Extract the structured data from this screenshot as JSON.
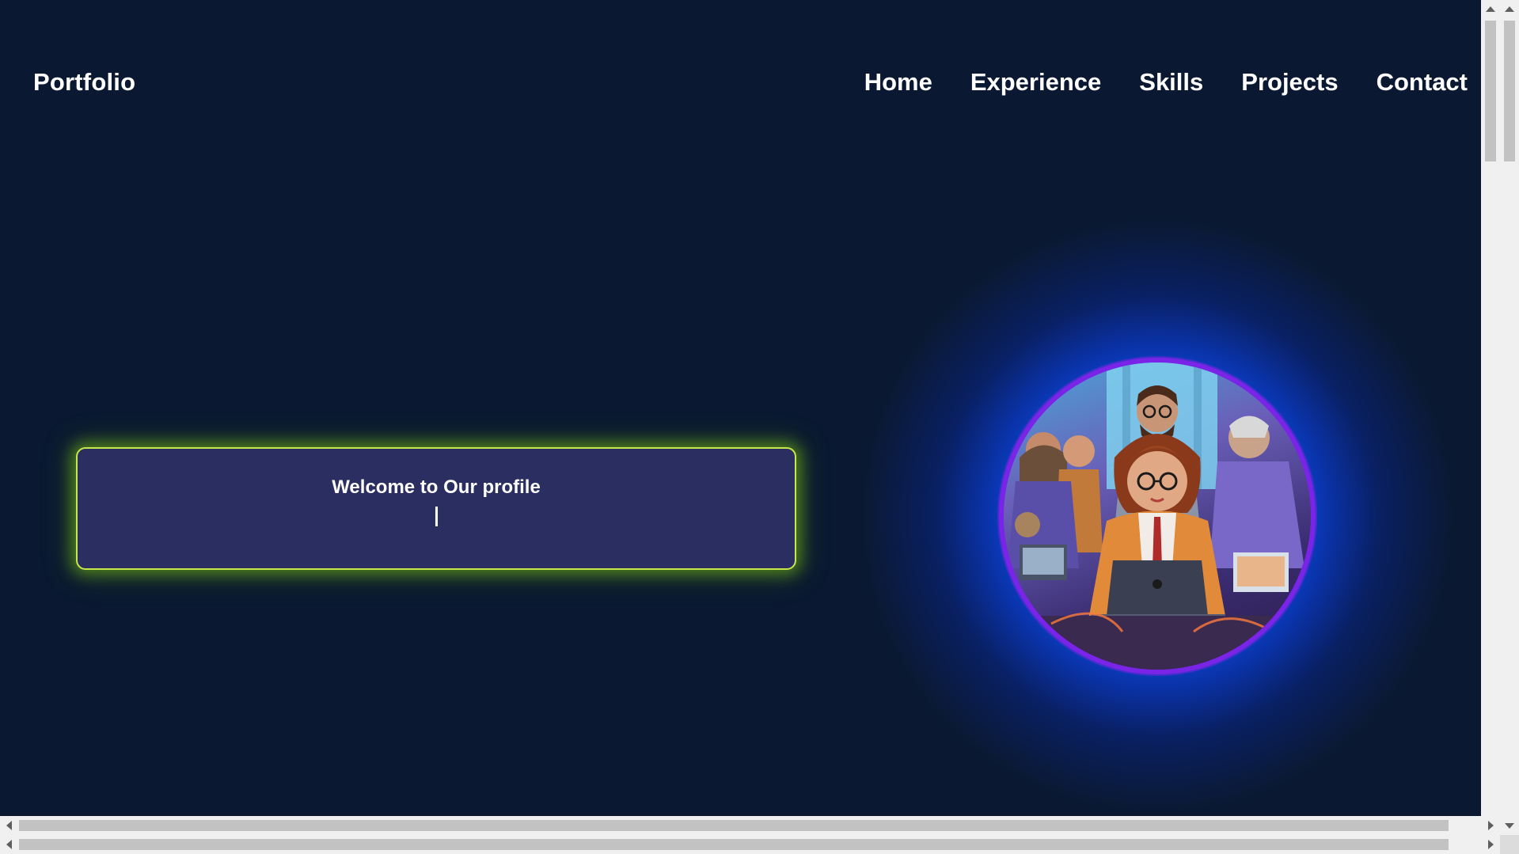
{
  "header": {
    "brand": "Portfolio",
    "nav": [
      {
        "label": "Home"
      },
      {
        "label": "Experience"
      },
      {
        "label": "Skills"
      },
      {
        "label": "Projects"
      },
      {
        "label": "Contact"
      }
    ]
  },
  "hero": {
    "welcome_title": "Welcome to Our profile",
    "avatar_icon": "team-illustration"
  },
  "colors": {
    "background": "#0a1931",
    "card_background": "#2a2e60",
    "card_border": "#c6e84a",
    "avatar_border": "#7a24e8",
    "glow": "#125aff"
  }
}
